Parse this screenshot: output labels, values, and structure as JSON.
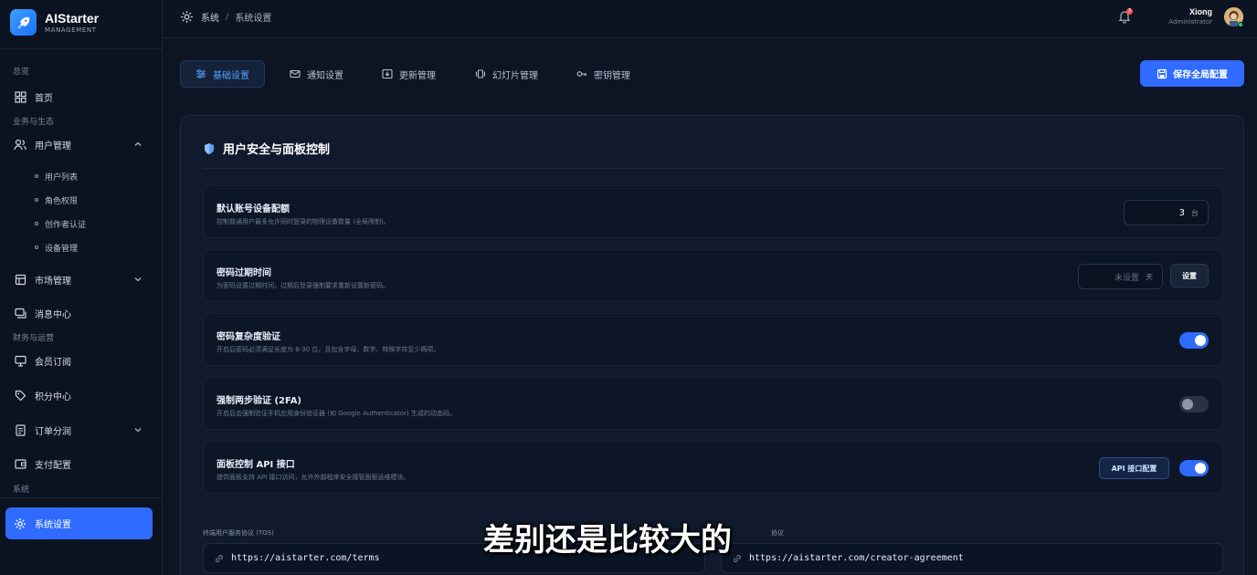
{
  "brand": {
    "name": "AIStarter",
    "subtitle": "MANAGEMENT"
  },
  "sidebar": {
    "sections": {
      "overview": "总览",
      "business": "业务与生态",
      "finance": "财务与运营",
      "system": "系统"
    },
    "items": {
      "home": "首页",
      "users": "用户管理",
      "user_list": "用户列表",
      "roles": "角色权限",
      "creator_auth": "创作者认证",
      "devices": "设备管理",
      "market": "市场管理",
      "messages": "消息中心",
      "membership": "会员订阅",
      "points": "积分中心",
      "orders": "订单分润",
      "payment": "支付配置",
      "settings": "系统设置"
    }
  },
  "header": {
    "breadcrumb_root": "系统",
    "breadcrumb_separator": "/",
    "breadcrumb_current": "系统设置",
    "notification_count": "3",
    "user_name": "Xiong",
    "user_role": "Administrator"
  },
  "tabs": [
    {
      "label": "基础设置",
      "active": true
    },
    {
      "label": "通知设置",
      "active": false
    },
    {
      "label": "更新管理",
      "active": false
    },
    {
      "label": "幻灯片管理",
      "active": false
    },
    {
      "label": "密钥管理",
      "active": false
    }
  ],
  "save_button": "保存全局配置",
  "card": {
    "title": "用户安全与面板控制",
    "rows": [
      {
        "title": "默认账号设备配额",
        "desc": "控制普通用户最多允许同时登录的物理设备数量 (全局限制)。",
        "value": "3",
        "unit": "台"
      },
      {
        "title": "密码过期时间",
        "desc": "为密码设置过期时间，过期后登录强制要求重新设置新密码。",
        "placeholder": "未设置",
        "unit": "天",
        "button": "设置"
      },
      {
        "title": "密码复杂度验证",
        "desc": "开启后密码必须满足长度为 8-30 位、且包含字母、数字、特殊字符至少两项。",
        "enabled": true
      },
      {
        "title": "强制两步验证 (2FA)",
        "desc": "开启后会强制验证手机应用身份验证器 (如 Google Authenticator) 生成的动态码。",
        "enabled": false
      },
      {
        "title": "面板控制 API 接口",
        "desc": "提供面板支持 API 接口访问，允许外部程序安全接管面板运维模块。",
        "button": "API 接口配置",
        "enabled": true
      }
    ],
    "tos_label": "终端用户服务协议 (TOS)",
    "tos_url": "https://aistarter.com/terms",
    "creator_label": "协议",
    "creator_url": "https://aistarter.com/creator-agreement"
  },
  "subtitle_text": "差别还是比较大的",
  "colors": {
    "accent": "#2f6bff",
    "background": "#0d1424"
  }
}
